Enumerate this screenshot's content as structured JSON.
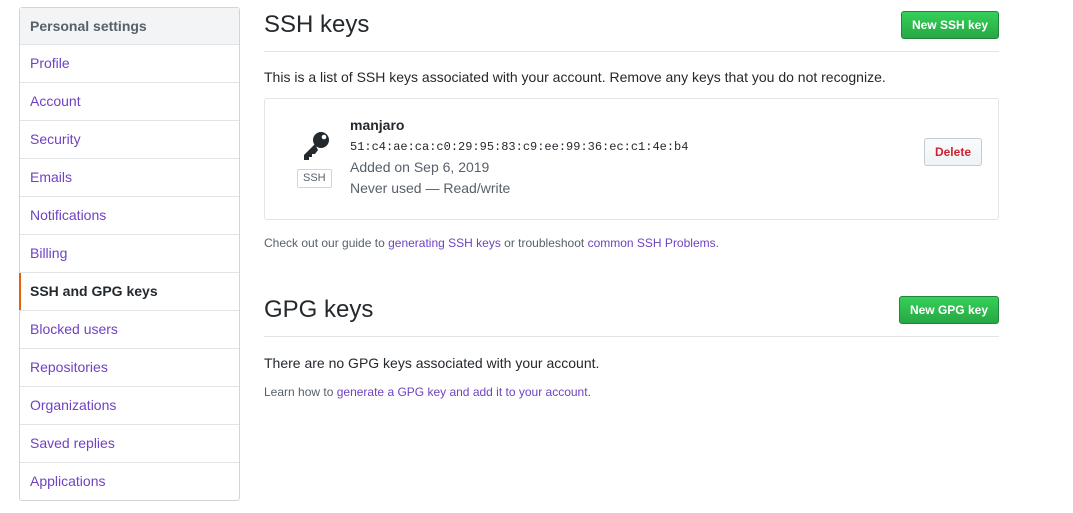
{
  "sidebar": {
    "header": "Personal settings",
    "items": [
      {
        "label": "Profile"
      },
      {
        "label": "Account"
      },
      {
        "label": "Security"
      },
      {
        "label": "Emails"
      },
      {
        "label": "Notifications"
      },
      {
        "label": "Billing"
      },
      {
        "label": "SSH and GPG keys"
      },
      {
        "label": "Blocked users"
      },
      {
        "label": "Repositories"
      },
      {
        "label": "Organizations"
      },
      {
        "label": "Saved replies"
      },
      {
        "label": "Applications"
      }
    ],
    "selected_index": 6
  },
  "ssh": {
    "title": "SSH keys",
    "new_button": "New SSH key",
    "intro": "This is a list of SSH keys associated with your account. Remove any keys that you do not recognize.",
    "keys": [
      {
        "name": "manjaro",
        "fingerprint": "51:c4:ae:ca:c0:29:95:83:c9:ee:99:36:ec:c1:4e:b4",
        "added": "Added on Sep 6, 2019",
        "usage": "Never used — Read/write",
        "type_label": "SSH",
        "icon": "key-icon",
        "delete_label": "Delete"
      }
    ],
    "guide_prefix": "Check out our guide to",
    "guide_link": "generating SSH keys",
    "guide_middle": "or troubleshoot",
    "guide_link2": "common SSH Problems",
    "guide_suffix": "."
  },
  "gpg": {
    "title": "GPG keys",
    "new_button": "New GPG key",
    "empty": "There are no GPG keys associated with your account.",
    "learn_prefix": "Learn how to",
    "learn_link": "generate a GPG key and add it to your account",
    "learn_suffix": "."
  },
  "colors": {
    "link": "#6f42c1",
    "primary_button": "#2cbe4e",
    "danger": "#cb2431",
    "selected_indicator": "#e36209"
  }
}
